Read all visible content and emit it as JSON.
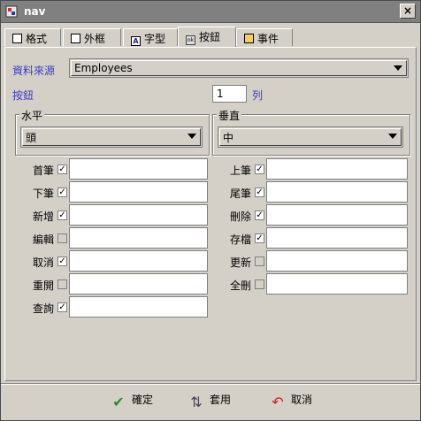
{
  "window": {
    "title": "nav",
    "close_label": "×"
  },
  "tabs": [
    {
      "label": "格式",
      "icon": "format-icon"
    },
    {
      "label": "外框",
      "icon": "border-icon"
    },
    {
      "label": "字型",
      "icon": "font-icon"
    },
    {
      "label": "按鈕",
      "icon": "button-icon",
      "active": true
    },
    {
      "label": "事件",
      "icon": "event-icon"
    }
  ],
  "form": {
    "data_source_label": "資料來源",
    "data_source_value": "Employees",
    "button_label": "按鈕",
    "button_count": "1",
    "column_label": "列"
  },
  "horizontal": {
    "title": "水平",
    "value": "頭"
  },
  "vertical": {
    "title": "垂直",
    "value": "中"
  },
  "left_rows": [
    {
      "label": "首筆",
      "checked": true,
      "enabled": true
    },
    {
      "label": "下筆",
      "checked": true,
      "enabled": true
    },
    {
      "label": "新增",
      "checked": true,
      "enabled": true
    },
    {
      "label": "編輯",
      "checked": false,
      "enabled": false
    },
    {
      "label": "取消",
      "checked": true,
      "enabled": true
    },
    {
      "label": "重開",
      "checked": false,
      "enabled": false
    },
    {
      "label": "查詢",
      "checked": true,
      "enabled": true
    }
  ],
  "right_rows": [
    {
      "label": "上筆",
      "checked": true,
      "enabled": true
    },
    {
      "label": "尾筆",
      "checked": true,
      "enabled": true
    },
    {
      "label": "刪除",
      "checked": true,
      "enabled": true
    },
    {
      "label": "存檔",
      "checked": true,
      "enabled": true
    },
    {
      "label": "更新",
      "checked": false,
      "enabled": false
    },
    {
      "label": "全刪",
      "checked": false,
      "enabled": false
    }
  ],
  "footer": {
    "ok_label": "確定",
    "apply_label": "套用",
    "cancel_label": "取消"
  },
  "colors": {
    "label_blue": "#3b3bc2",
    "ok_green": "#2e8b2e",
    "cancel_red": "#cc2222"
  }
}
